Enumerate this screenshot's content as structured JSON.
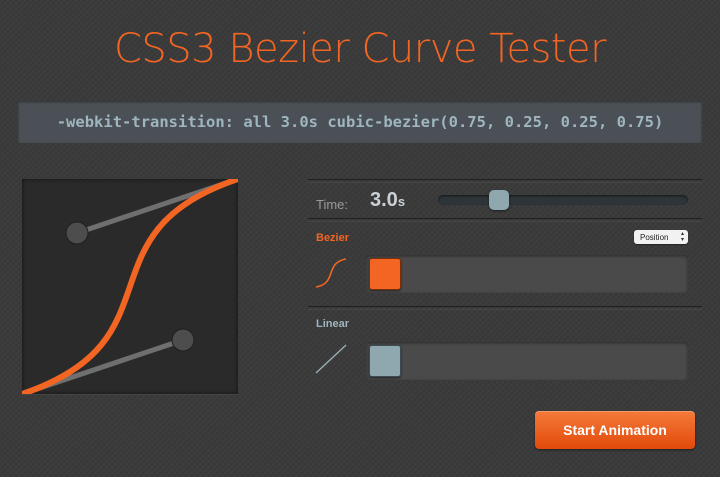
{
  "page": {
    "title": "CSS3 Bezier Curve Tester",
    "code": "-webkit-transition: all 3.0s cubic-bezier(0.75, 0.25, 0.25, 0.75)"
  },
  "controls": {
    "time_label": "Time:",
    "time_value": "3.0",
    "time_unit": "s",
    "time_slider_fraction": 0.22
  },
  "bezier": {
    "label": "Bezier",
    "select_value": "Position",
    "control_points": [
      [
        0.75,
        0.25
      ],
      [
        0.25,
        0.75
      ]
    ],
    "block_progress": 0
  },
  "linear": {
    "label": "Linear",
    "block_progress": 0
  },
  "actions": {
    "start_label": "Start Animation"
  },
  "colors": {
    "accent": "#f26522",
    "secondary": "#8fa8b0",
    "background": "#3a3a3a"
  },
  "icons": {
    "bezier_preview": "s-curve-icon",
    "linear_preview": "diagonal-line-icon",
    "select_arrows": "updown-arrows-icon"
  }
}
